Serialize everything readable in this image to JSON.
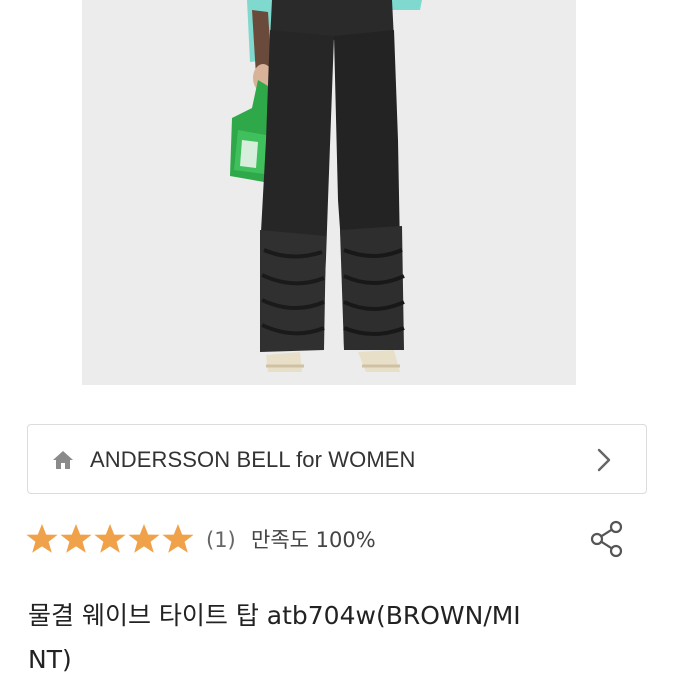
{
  "product_image": {
    "alt": "product-photo"
  },
  "brand": {
    "name": "ANDERSSON BELL for WOMEN",
    "icon": "home-icon",
    "chevron": "chevron-right-icon"
  },
  "rating": {
    "stars": 5,
    "max": 5,
    "review_count": "(1)",
    "satisfaction": "만족도 100%",
    "star_color": "#f0a24a"
  },
  "share": {
    "icon": "share-icon"
  },
  "product": {
    "title": "물결 웨이브 타이트 탑 atb704w(BROWN/MINT)"
  }
}
